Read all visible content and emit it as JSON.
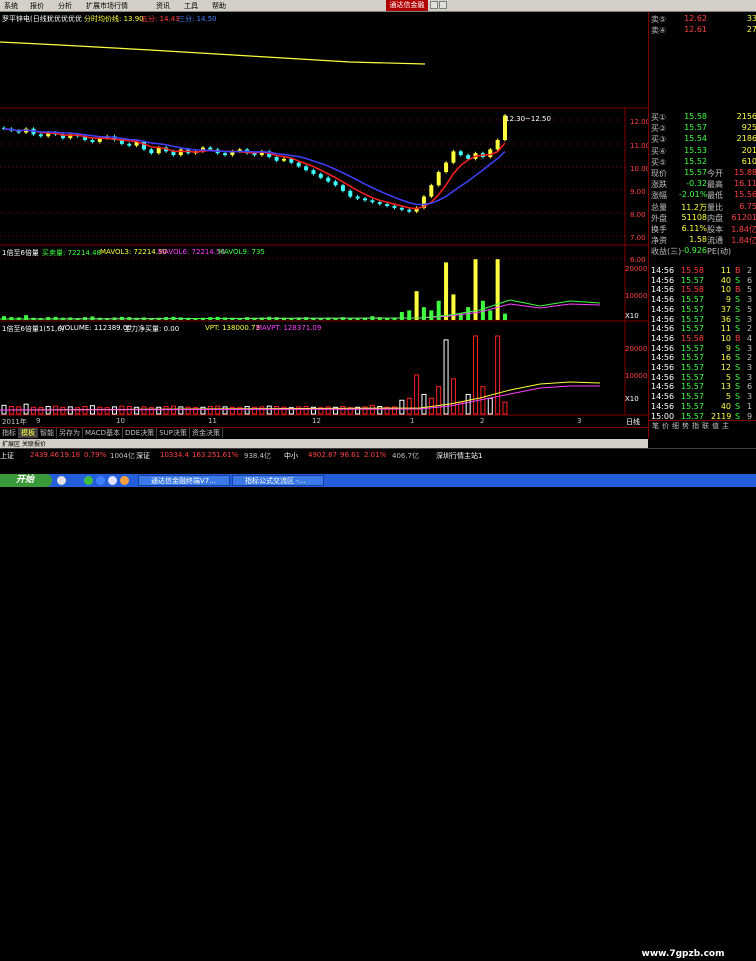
{
  "menu": [
    "系统",
    "报价",
    "分析",
    "扩展市场行情",
    "资讯",
    "工具",
    "帮助"
  ],
  "brand": "通达信金融",
  "header": {
    "title": "罗平锌电(日线)",
    "opts": "优优优优优",
    "fenshi": "分时均价线: 13.90",
    "ma1": "五分: 14.43",
    "ma2": "三分: 14.50"
  },
  "price_axis": [
    "12.00",
    "11.00",
    "10.00",
    "9.00",
    "8.00",
    "7.00",
    "6.00"
  ],
  "price_label": "12.30~12.50",
  "vol_header": {
    "name": "1倍至6倍量",
    "l1": "买卖量: 72214.48",
    "l2": "MAVOL3: 72214.50",
    "l3": "MAVOL6: 72214.50",
    "l4": "MAVOL9: 735"
  },
  "vol_axis": [
    "20000",
    "10000",
    "X10"
  ],
  "vpt_header": {
    "name": "1倍至6倍量1(51,6)",
    "vol": "VOLUME: 112389.00",
    "main": "主力净买量: 0.00",
    "vpt": "VPT: 138000.73",
    "mavpt": "MAVPT: 128371.09"
  },
  "vpt_axis": [
    "20000",
    "10000",
    "X10"
  ],
  "date_axis": [
    "2011年",
    "9",
    "10",
    "11",
    "12",
    "1",
    "2",
    "3"
  ],
  "date_suffix": "日线",
  "quote": {
    "sells": [
      {
        "l": "卖⑤",
        "p": "12.62",
        "v": "33"
      },
      {
        "l": "卖④",
        "p": "12.61",
        "v": "27"
      }
    ],
    "buys": [
      {
        "l": "买①",
        "p": "15.58",
        "v": "2156"
      },
      {
        "l": "买②",
        "p": "15.57",
        "v": "925"
      },
      {
        "l": "买③",
        "p": "15.54",
        "v": "2186"
      },
      {
        "l": "买④",
        "p": "15.53",
        "v": "201"
      },
      {
        "l": "买⑤",
        "p": "15.52",
        "v": "610"
      }
    ],
    "stats": [
      {
        "a": "现价",
        "av": "15.57",
        "b": "今开",
        "bv": "15.88"
      },
      {
        "a": "涨跌",
        "av": "-0.32",
        "b": "最高",
        "bv": "16.11"
      },
      {
        "a": "涨幅",
        "av": "-2.01%",
        "b": "最低",
        "bv": "15.56"
      },
      {
        "a": "总量",
        "av": "11.2万",
        "b": "量比",
        "bv": "6.75"
      },
      {
        "a": "外盘",
        "av": "51108",
        "b": "内盘",
        "bv": "61201"
      },
      {
        "a": "换手",
        "av": "6.11%",
        "b": "股本",
        "bv": "1.84亿"
      },
      {
        "a": "净资",
        "av": "1.58",
        "b": "流通",
        "bv": "1.84亿"
      },
      {
        "a": "收益(三)",
        "av": "-0.926",
        "b": "PE(动)",
        "bv": ""
      }
    ],
    "ticks": [
      {
        "t": "14:56",
        "p": "15.58",
        "v": "11",
        "f": "B",
        "n": "2"
      },
      {
        "t": "14:56",
        "p": "15.57",
        "v": "40",
        "f": "S",
        "n": "6"
      },
      {
        "t": "14:56",
        "p": "15.58",
        "v": "10",
        "f": "B",
        "n": "5"
      },
      {
        "t": "14:56",
        "p": "15.57",
        "v": "9",
        "f": "S",
        "n": "3"
      },
      {
        "t": "14:56",
        "p": "15.57",
        "v": "37",
        "f": "S",
        "n": "5"
      },
      {
        "t": "14:56",
        "p": "15.57",
        "v": "36",
        "f": "S",
        "n": "3"
      },
      {
        "t": "14:56",
        "p": "15.57",
        "v": "11",
        "f": "S",
        "n": "2"
      },
      {
        "t": "14:56",
        "p": "15.58",
        "v": "10",
        "f": "B",
        "n": "4"
      },
      {
        "t": "14:56",
        "p": "15.57",
        "v": "9",
        "f": "S",
        "n": "3"
      },
      {
        "t": "14:56",
        "p": "15.57",
        "v": "16",
        "f": "S",
        "n": "2"
      },
      {
        "t": "14:56",
        "p": "15.57",
        "v": "12",
        "f": "S",
        "n": "3"
      },
      {
        "t": "14:56",
        "p": "15.57",
        "v": "5",
        "f": "S",
        "n": "3"
      },
      {
        "t": "14:56",
        "p": "15.57",
        "v": "13",
        "f": "S",
        "n": "6"
      },
      {
        "t": "14:56",
        "p": "15.57",
        "v": "5",
        "f": "S",
        "n": "3"
      },
      {
        "t": "14:56",
        "p": "15.57",
        "v": "40",
        "f": "S",
        "n": "1"
      },
      {
        "t": "15:00",
        "p": "15.57",
        "v": "2119",
        "f": "S",
        "n": "9"
      }
    ],
    "tabs": [
      "笔",
      "价",
      "细",
      "势",
      "指",
      "联",
      "值",
      "主"
    ]
  },
  "bottom_tabs": [
    "指标",
    "模板",
    "智能",
    "另存为",
    "MACD基本",
    "DDE决策",
    "SUP决策",
    "资金决策"
  ],
  "bottom_tabs2": [
    "扩展区",
    "关联报价"
  ],
  "index_bar": [
    {
      "t": "上证",
      "c": "wht"
    },
    {
      "t": "2439.46",
      "c": "red"
    },
    {
      "t": "19.18",
      "c": "red"
    },
    {
      "t": "0.79%",
      "c": "red"
    },
    {
      "t": "1004亿",
      "c": "gry"
    },
    {
      "t": "深证",
      "c": "wht"
    },
    {
      "t": "10334.4",
      "c": "red"
    },
    {
      "t": "163.25",
      "c": "red"
    },
    {
      "t": "1.61%",
      "c": "red"
    },
    {
      "t": "938.4亿",
      "c": "gry"
    },
    {
      "t": "中小",
      "c": "wht"
    },
    {
      "t": "4902.87",
      "c": "red"
    },
    {
      "t": "96.61",
      "c": "red"
    },
    {
      "t": "2.01%",
      "c": "red"
    },
    {
      "t": "406.7亿",
      "c": "gry"
    },
    {
      "t": "深圳行情主站1",
      "c": "wht"
    }
  ],
  "taskbar": {
    "start": "开始",
    "items": [
      "通达信金融终端V7...",
      "指标公式交流区 -..."
    ]
  },
  "watermark": "www.7gpzb.com",
  "chart_data": {
    "type": "candlestick",
    "price_range": [
      5.8,
      12.7
    ],
    "closes": [
      11.6,
      11.5,
      11.4,
      11.6,
      11.3,
      11.2,
      11.4,
      11.3,
      11.1,
      11.3,
      11.2,
      11.0,
      10.9,
      11.1,
      11.2,
      11.0,
      10.8,
      10.7,
      10.9,
      10.5,
      10.3,
      10.6,
      10.4,
      10.2,
      10.5,
      10.3,
      10.4,
      10.6,
      10.5,
      10.3,
      10.2,
      10.4,
      10.5,
      10.3,
      10.2,
      10.4,
      10.1,
      9.9,
      10.0,
      9.8,
      9.6,
      9.4,
      9.2,
      9.0,
      8.8,
      8.6,
      8.3,
      8.0,
      7.9,
      7.8,
      7.7,
      7.6,
      7.5,
      7.4,
      7.3,
      7.2,
      7.4,
      8.0,
      8.6,
      9.3,
      9.8,
      10.4,
      10.2,
      10.0,
      10.3,
      10.1,
      10.5,
      11.0,
      12.3
    ],
    "volumes": [
      1200,
      900,
      800,
      1500,
      700,
      600,
      900,
      1000,
      700,
      800,
      600,
      900,
      1100,
      700,
      600,
      800,
      1000,
      900,
      700,
      800,
      600,
      700,
      900,
      1000,
      800,
      700,
      600,
      700,
      900,
      1000,
      800,
      700,
      600,
      900,
      700,
      800,
      1000,
      900,
      700,
      600,
      800,
      900,
      700,
      600,
      800,
      700,
      900,
      600,
      700,
      800,
      1200,
      900,
      700,
      800,
      2500,
      3000,
      9000,
      4000,
      3000,
      6000,
      18000,
      8000,
      2000,
      4000,
      19000,
      6000,
      3000,
      19000,
      2000
    ]
  }
}
